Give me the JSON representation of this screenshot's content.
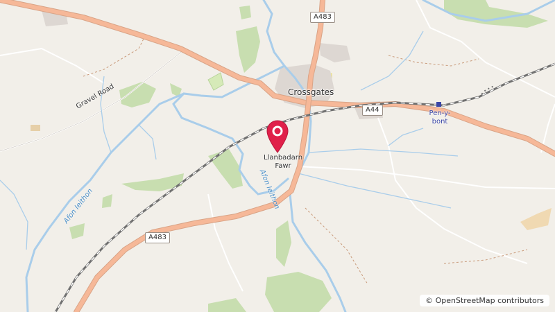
{
  "map": {
    "places": {
      "crossgates": "Crossgates",
      "llanbadarn_line1": "Llanbadarn",
      "llanbadarn_line2": "Fawr",
      "pen_y_bont_line1": "Pen-y-",
      "pen_y_bont_line2": "bont"
    },
    "roads": {
      "a483_top": "A483",
      "a44": "A44",
      "a483_bottom": "A483",
      "gravel_road": "Gravel Road"
    },
    "waterways": {
      "afon_ieithon_west": "Afon Ieithon",
      "afon_ieithon_center": "Afon Ieithon"
    },
    "marker": {
      "icon": "map-pin-icon",
      "color": "#e0204a"
    },
    "attribution": "© OpenStreetMap contributors"
  }
}
